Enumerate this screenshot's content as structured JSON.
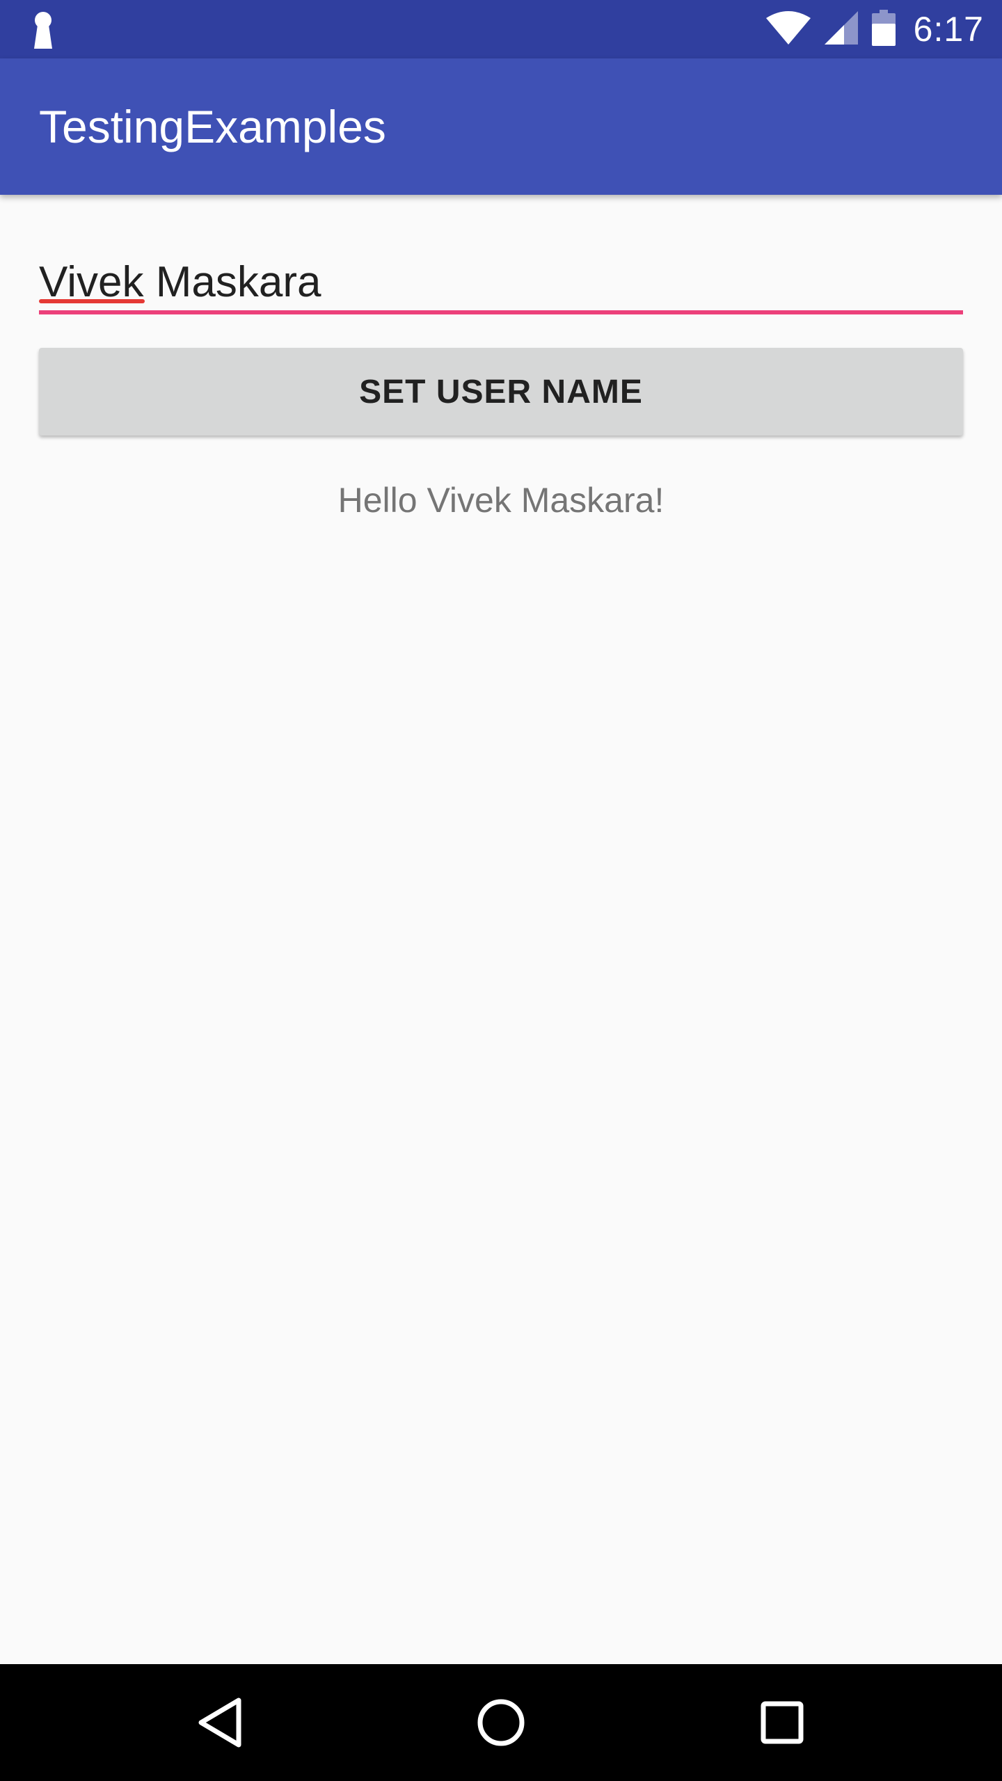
{
  "status_bar": {
    "time": "6:17",
    "icons": [
      "keyhole-icon",
      "wifi-icon",
      "cell-signal-icon",
      "battery-icon"
    ]
  },
  "app_bar": {
    "title": "TestingExamples",
    "color": "#3f51b5"
  },
  "form": {
    "name_value": "Vivek Maskara",
    "accent_color": "#ec407a",
    "button_label": "SET USER NAME",
    "greeting": "Hello Vivek Maskara!"
  },
  "nav_bar": {
    "buttons": [
      "back-icon",
      "home-icon",
      "recents-icon"
    ]
  }
}
